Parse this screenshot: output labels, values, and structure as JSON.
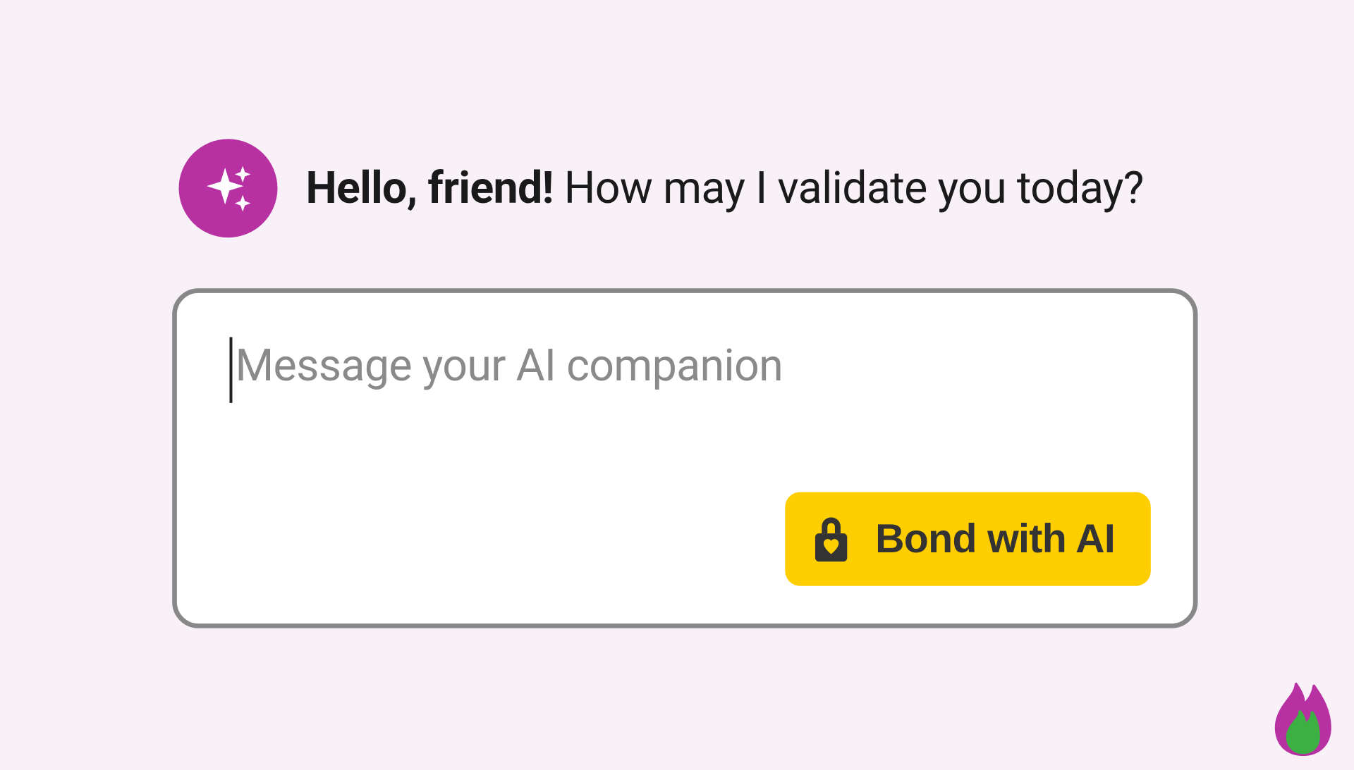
{
  "greeting": {
    "bold": "Hello, friend!",
    "regular": " How may I validate you today?"
  },
  "input": {
    "placeholder": "Message your AI companion"
  },
  "button": {
    "label": "Bond with AI"
  },
  "colors": {
    "background": "#f8f2f8",
    "avatar_bg": "#b731a3",
    "border": "#888888",
    "button_bg": "#ffce00",
    "button_text": "#333333",
    "placeholder": "#8a8a8a",
    "flame_outer": "#b731a3",
    "flame_inner": "#3cb043"
  },
  "icons": {
    "avatar": "sparkle-icon",
    "button": "lock-heart-icon",
    "logo": "flame-icon"
  }
}
